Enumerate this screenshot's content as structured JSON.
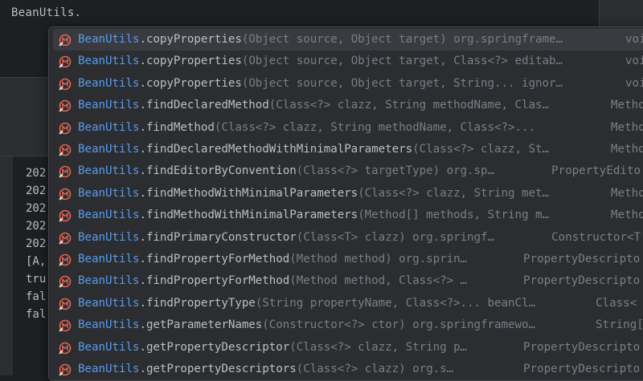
{
  "editor": {
    "code_line": "BeanUtils."
  },
  "console": {
    "lines": [
      "202",
      "202",
      "202",
      "202",
      "202",
      "[A,",
      "tru",
      "fal",
      "fal"
    ]
  },
  "completion": {
    "class_name": "BeanUtils",
    "items": [
      {
        "method": "copyProperties",
        "params": "(Object source, Object target) org.springframe…",
        "ret": "voi",
        "selected": true
      },
      {
        "method": "copyProperties",
        "params": "(Object source, Object target, Class<?> editab…",
        "ret": "voi"
      },
      {
        "method": "copyProperties",
        "params": "(Object source, Object target, String... ignor…",
        "ret": "voi"
      },
      {
        "method": "findDeclaredMethod",
        "params": "(Class<?> clazz, String methodName, Clas…",
        "ret": "Metho"
      },
      {
        "method": "findMethod",
        "params": "(Class<?> clazz, String methodName, Class<?>... ",
        "ret": "Metho"
      },
      {
        "method": "findDeclaredMethodWithMinimalParameters",
        "params": "(Class<?> clazz, St…",
        "ret": "Metho"
      },
      {
        "method": "findEditorByConvention",
        "params": "(Class<?> targetType) org.sp…",
        "ret": "PropertyEdito"
      },
      {
        "method": "findMethodWithMinimalParameters",
        "params": "(Class<?> clazz, String met…",
        "ret": "Metho"
      },
      {
        "method": "findMethodWithMinimalParameters",
        "params": "(Method[] methods, String m…",
        "ret": "Metho"
      },
      {
        "method": "findPrimaryConstructor",
        "params": "(Class<T> clazz) org.springf…",
        "ret": "Constructor<T"
      },
      {
        "method": "findPropertyForMethod",
        "params": "(Method method) org.sprin…",
        "ret": "PropertyDescripto"
      },
      {
        "method": "findPropertyForMethod",
        "params": "(Method method, Class<?> …",
        "ret": "PropertyDescripto"
      },
      {
        "method": "findPropertyType",
        "params": "(String propertyName, Class<?>... beanCl…",
        "ret": "Class<"
      },
      {
        "method": "getParameterNames",
        "params": "(Constructor<?> ctor) org.springframewo…",
        "ret": "String["
      },
      {
        "method": "getPropertyDescriptor",
        "params": "(Class<?> clazz, String p…",
        "ret": "PropertyDescripto"
      },
      {
        "method": "getPropertyDescriptors",
        "params": "(Class<?> clazz) org.s…",
        "ret": "PropertyDescripto"
      }
    ]
  },
  "colors": {
    "class": "#5c9ae8",
    "method": "#bcbec4",
    "params": "#7a7e85",
    "icon": "#e8634f"
  },
  "icons": {
    "item_icon": "method-icon"
  }
}
